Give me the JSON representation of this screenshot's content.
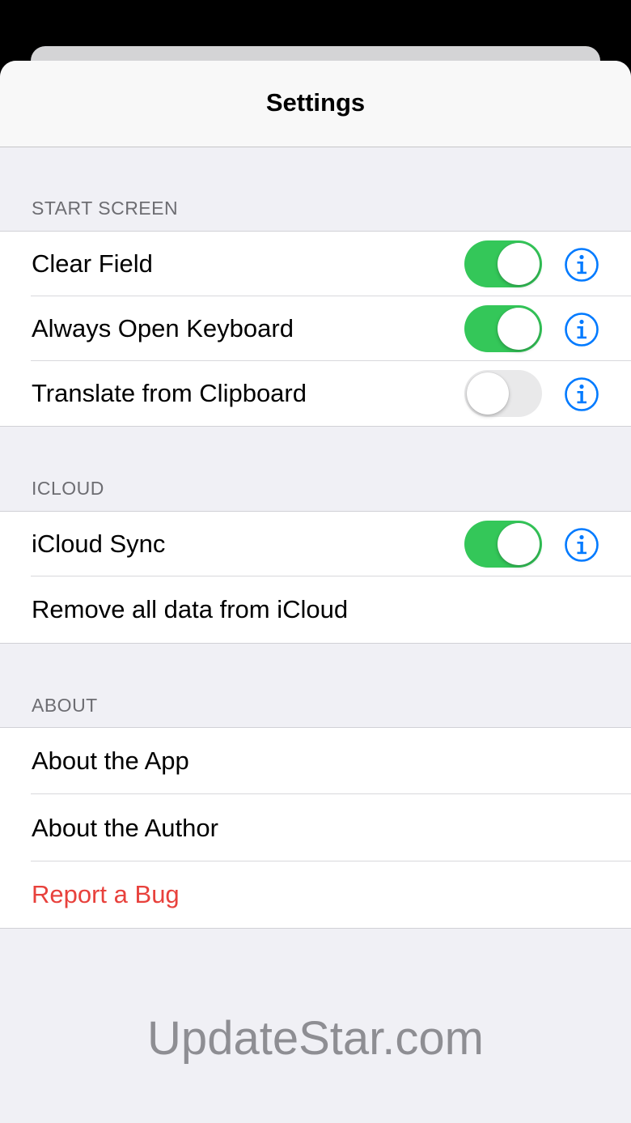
{
  "nav": {
    "title": "Settings"
  },
  "sections": [
    {
      "header": "START SCREEN",
      "rows": [
        {
          "label": "Clear Field",
          "toggle": true,
          "info_icon": "info-circle-icon"
        },
        {
          "label": "Always Open Keyboard",
          "toggle": true,
          "info_icon": "info-circle-icon"
        },
        {
          "label": "Translate from Clipboard",
          "toggle": false,
          "info_icon": "info-circle-icon"
        }
      ]
    },
    {
      "header": "ICLOUD",
      "rows": [
        {
          "label": "iCloud Sync",
          "toggle": true,
          "info_icon": "info-circle-icon"
        },
        {
          "label": "Remove all data from iCloud"
        }
      ]
    },
    {
      "header": "ABOUT",
      "rows": [
        {
          "label": "About the App"
        },
        {
          "label": "About the Author"
        },
        {
          "label": "Report a Bug",
          "style": "destructive"
        }
      ]
    }
  ],
  "watermark": "UpdateStar.com",
  "colors": {
    "toggle_on": "#34c759",
    "toggle_off": "#e9e9ea",
    "accent": "#007aff",
    "destructive": "#e8413c",
    "section_header": "#6d6d72",
    "background": "#f0f0f5"
  }
}
